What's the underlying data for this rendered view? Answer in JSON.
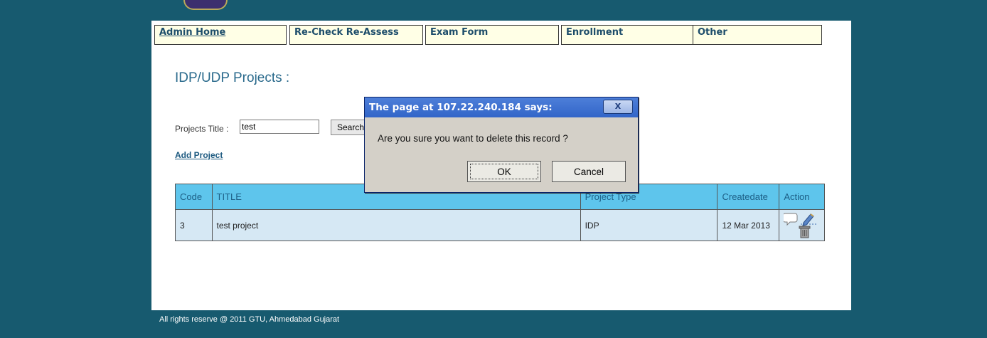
{
  "nav": {
    "items": [
      {
        "label": "Admin Home"
      },
      {
        "label": "Re-Check Re-Assess"
      },
      {
        "label": "Exam Form"
      },
      {
        "label": "Enrollment"
      },
      {
        "label": "Other"
      }
    ]
  },
  "main": {
    "title": "IDP/UDP Projects :",
    "search": {
      "label": "Projects Title :",
      "value": "test",
      "button_label": "Search"
    },
    "add_link": "Add Project",
    "table": {
      "headers": [
        "Code",
        "TITLE",
        "Project Type",
        "Createdate",
        "Action"
      ],
      "rows": [
        {
          "code": "3",
          "title": "test project",
          "type": "IDP",
          "date": "12 Mar 2013"
        }
      ]
    }
  },
  "dialog": {
    "title": "The page at 107.22.240.184 says:",
    "close_label": "X",
    "message": "Are you sure you want to delete this record ?",
    "ok_label": "OK",
    "cancel_label": "Cancel"
  },
  "footer": {
    "text": "All rights reserve @ 2011 GTU, Ahmedabad Gujarat"
  },
  "icons": {
    "comment": "comment-icon",
    "edit": "edit-icon",
    "delete": "trash-icon"
  }
}
